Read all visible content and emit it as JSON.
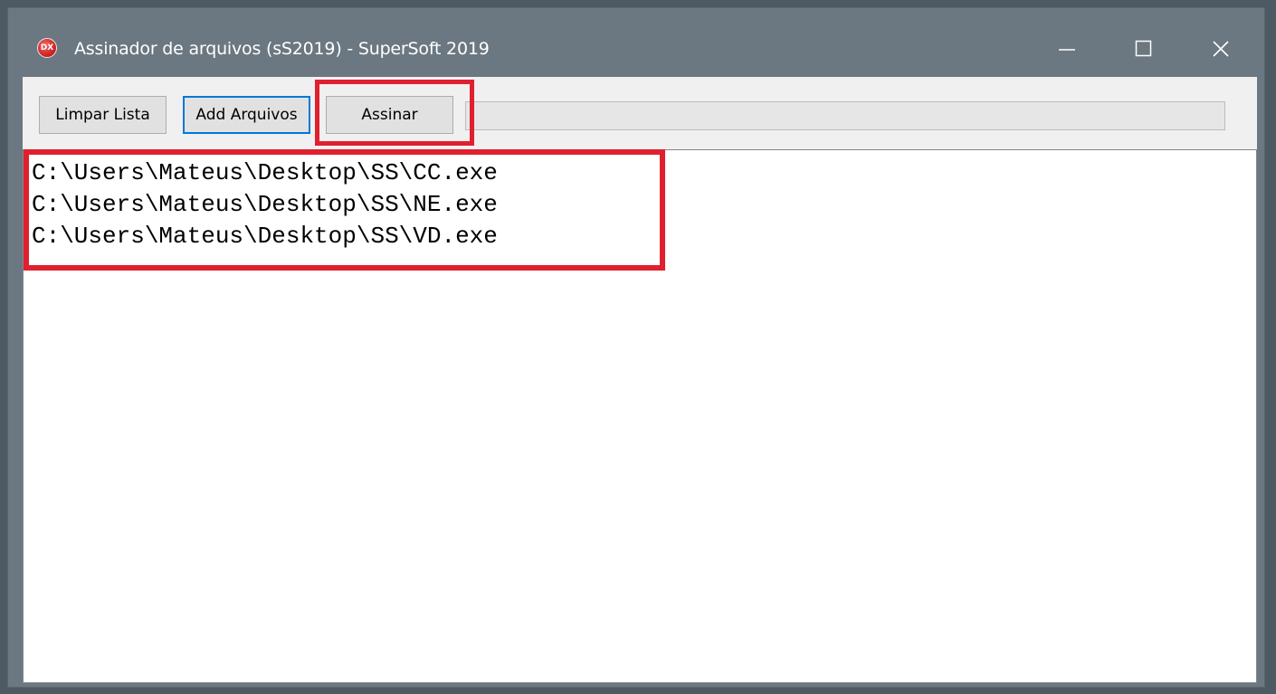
{
  "window": {
    "title": "Assinador de arquivos (sS2019) - SuperSoft 2019",
    "app_icon_label": "DX"
  },
  "toolbar": {
    "clear_label": "Limpar Lista",
    "add_label": "Add Arquivos",
    "sign_label": "Assinar"
  },
  "file_list": {
    "items": [
      "C:\\Users\\Mateus\\Desktop\\SS\\CC.exe",
      "C:\\Users\\Mateus\\Desktop\\SS\\NE.exe",
      "C:\\Users\\Mateus\\Desktop\\SS\\VD.exe"
    ]
  },
  "colors": {
    "highlight": "#e0202e",
    "focus_border": "#0078d7",
    "titlebar": "#6b7781"
  },
  "icons": {
    "app": "dx-logo-icon",
    "minimize": "minimize-icon",
    "maximize": "maximize-icon",
    "close": "close-icon"
  }
}
